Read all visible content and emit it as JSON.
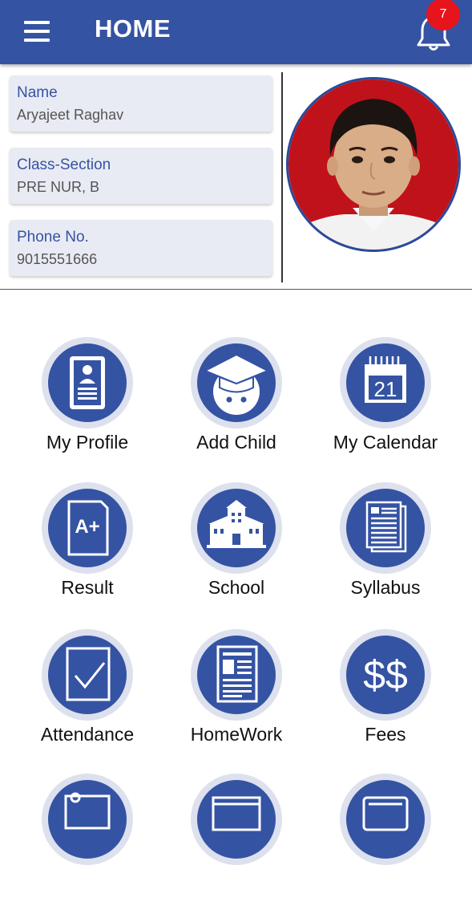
{
  "header": {
    "title": "HOME",
    "menu_icon": "hamburger-menu-icon",
    "bell_icon": "bell-icon",
    "notification_count": "7",
    "color": "#3553a3"
  },
  "profile": {
    "fields": [
      {
        "label": "Name",
        "value": "Aryajeet Raghav"
      },
      {
        "label": "Class-Section",
        "value": "PRE NUR, B"
      },
      {
        "label": "Phone No.",
        "value": "9015551666"
      }
    ]
  },
  "menu": {
    "items": [
      {
        "label": "My Profile",
        "icon": "profile-card-icon"
      },
      {
        "label": "Add Child",
        "icon": "graduate-face-icon"
      },
      {
        "label": "My Calendar",
        "icon": "calendar-icon",
        "day": "21"
      },
      {
        "label": "Result",
        "icon": "report-card-icon",
        "grade": "A+"
      },
      {
        "label": "School",
        "icon": "school-building-icon"
      },
      {
        "label": "Syllabus",
        "icon": "documents-icon"
      },
      {
        "label": "Attendance",
        "icon": "checkbox-icon"
      },
      {
        "label": "HomeWork",
        "icon": "homework-document-icon"
      },
      {
        "label": "Fees",
        "icon": "fees-dollar-icon",
        "symbol": "$$"
      }
    ]
  }
}
